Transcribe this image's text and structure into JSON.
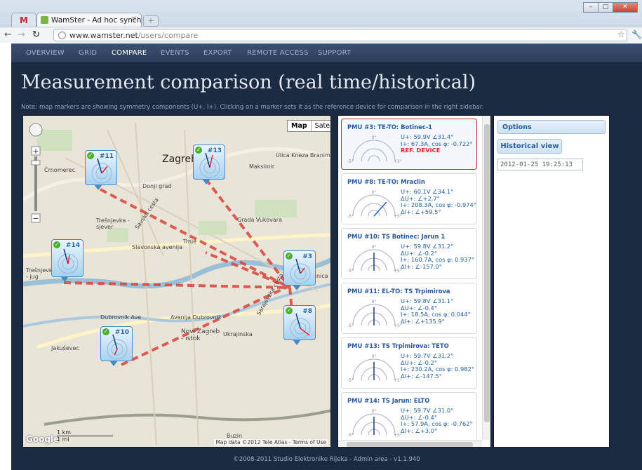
{
  "browser": {
    "gmail_tab": "M",
    "tab_title": "WamSter - Ad hoc synchro",
    "url_host": "www.wamster.net",
    "url_path": "/users/compare"
  },
  "menu": [
    "OVERVIEW",
    "GRID",
    "COMPARE",
    "EVENTS",
    "EXPORT",
    "REMOTE ACCESS",
    "SUPPORT"
  ],
  "page": {
    "title": "Measurement comparison (real time/historical)",
    "note": "Note: map markers are showing symmetry components (U+, I+). Clicking on a marker sets it as the reference device for comparison in the right sidebar."
  },
  "map": {
    "type_map": "Map",
    "type_satellite": "Satellite",
    "markers": [
      "#11",
      "#13",
      "#14",
      "#3",
      "#8",
      "#10"
    ],
    "labels": [
      "Zagreb",
      "Maksimir",
      "Črnomerec",
      "Donji grad",
      "Trešnjevka - sjever",
      "Slavonska avenija",
      "Trnje",
      "Grada Vukovara",
      "Peščenica",
      "Trešnjevka - jug",
      "Dubrovnik Ave",
      "Avenija Dubrovnik",
      "Novi Zagreb - istok",
      "Jakuševec",
      "Buzin",
      "Ulica Kneza Branimira",
      "Ukrajinska",
      "Sarajevska cesta",
      "Savska cesta"
    ],
    "scale_km": "1 km",
    "scale_mi": "1 mi",
    "google": "Google",
    "attribution": "Map data ©2012 Tele Atlas - Terms of Use"
  },
  "pmus": [
    {
      "title": "PMU #3:   TE-TO: Botinec-1",
      "lines": [
        "U+: 59.9V  ∠31.4°",
        "I+: 67.3A, cos φ: -0.722°",
        "REF. DEVICE"
      ]
    },
    {
      "title": "PMU #8:   TE-TO: Mraclin",
      "lines": [
        "U+: 60.1V  ∠34.1°",
        "ΔU+:  ∠+2.7°",
        "I+: 208.3A, cos φ: -0.974°",
        "ΔI+:  ∠+59.5°"
      ]
    },
    {
      "title": "PMU #10:  TS Botinec: Jarun 1",
      "lines": [
        "U+: 59.8V  ∠31.2°",
        "ΔU+:  ∠-0.2°",
        "I+: 160.7A, cos φ: 0.937°",
        "ΔI+:  ∠-157.0°"
      ]
    },
    {
      "title": "PMU #11:  EL-TO: TS Trpimirova",
      "lines": [
        "U+: 59.8V  ∠31.1°",
        "ΔU+:  ∠-0.4°",
        "I+: 18.5A, cos φ: 0.044°",
        "ΔI+:  ∠+135.9°"
      ]
    },
    {
      "title": "PMU #13:  TS Trpimirova: TETO",
      "lines": [
        "U+: 59.7V  ∠31.2°",
        "ΔU+:  ∠-0.2°",
        "I+: 230.2A, cos φ: 0.982°",
        "ΔI+:  ∠-147.5°"
      ]
    },
    {
      "title": "PMU #14:  TS Jarun: ELTO",
      "lines": [
        "U+: 59.7V  ∠31.0°",
        "ΔU+:  ∠-0.4°",
        "I+: 57.9A, cos φ: -0.762°",
        "ΔI+:  ∠+3.0°"
      ]
    }
  ],
  "phasor_labels": {
    "top": "0°",
    "left": "-5°",
    "right": "+5°"
  },
  "options": {
    "header": "Options",
    "historical_button": "Historical view",
    "datetime_value": "2012-01-25 19:25:13"
  },
  "footer": "©2008-2011 Studio Elektronike Rijeka - Admin area - v1.1.940"
}
